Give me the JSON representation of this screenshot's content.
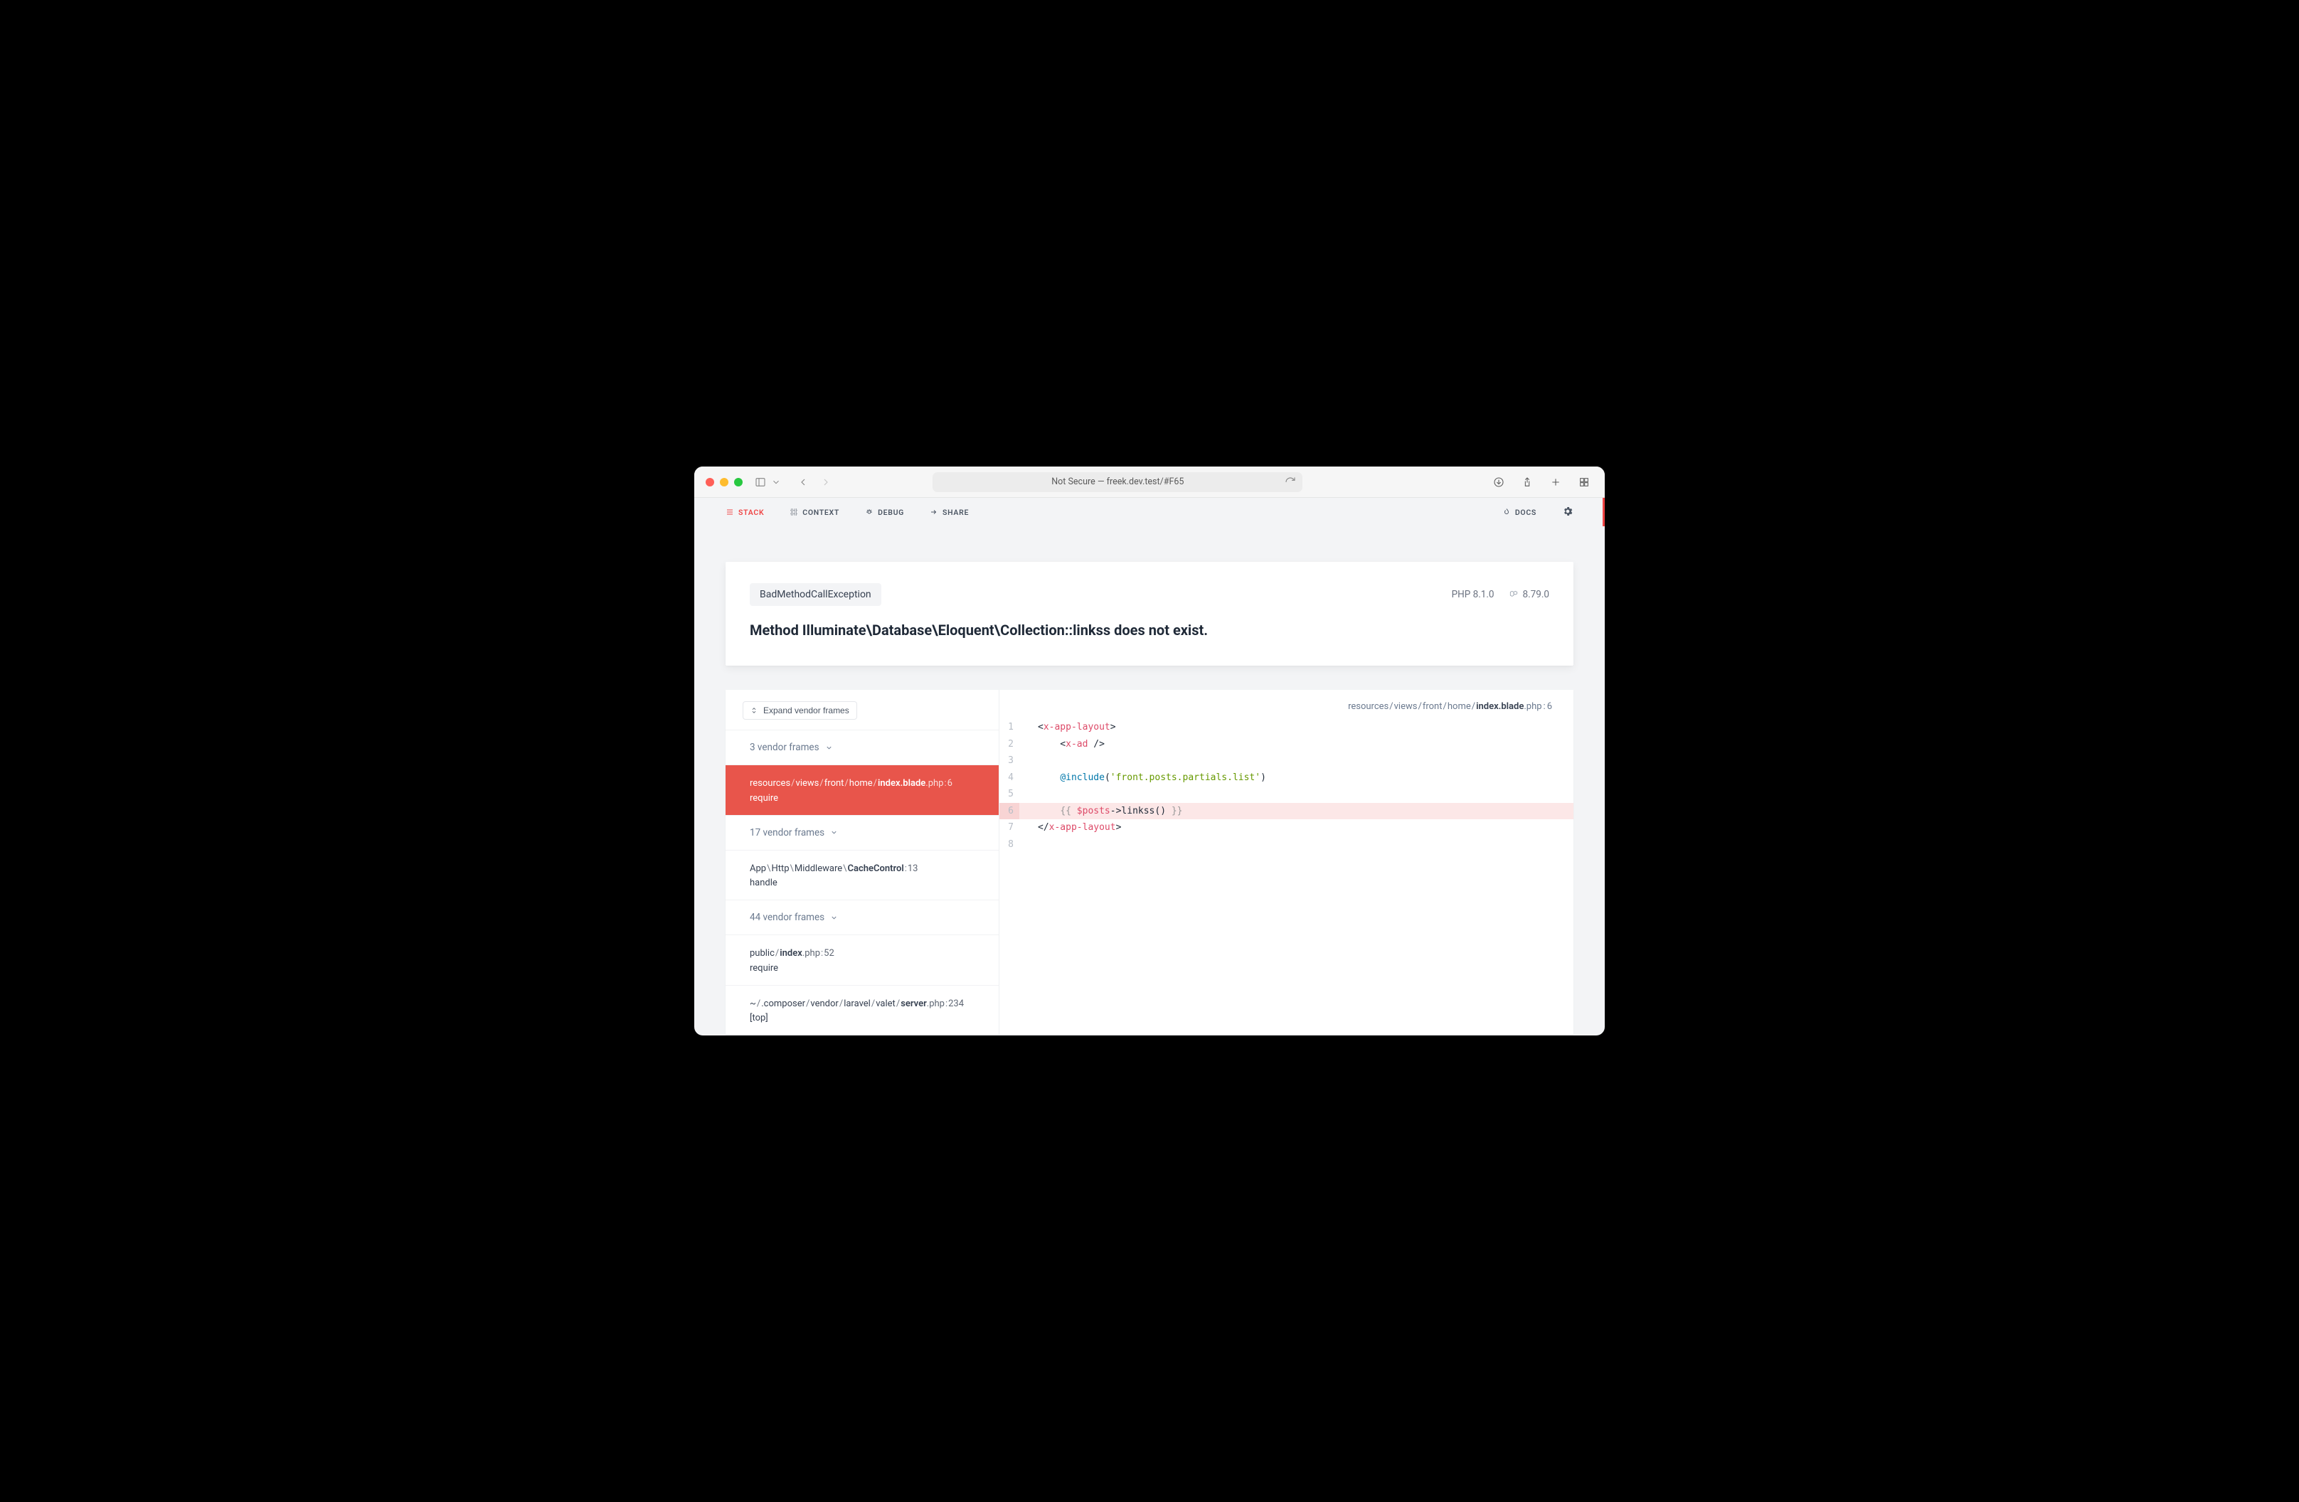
{
  "browser": {
    "url_display": "Not Secure — freek.dev.test/#F65"
  },
  "nav": {
    "items": [
      {
        "label": "STACK",
        "key": "stack",
        "active": true
      },
      {
        "label": "CONTEXT",
        "key": "context",
        "active": false
      },
      {
        "label": "DEBUG",
        "key": "debug",
        "active": false
      },
      {
        "label": "SHARE",
        "key": "share",
        "active": false
      }
    ],
    "right": {
      "docs": "DOCS"
    }
  },
  "error": {
    "exception_class": "BadMethodCallException",
    "message": "Method Illuminate\\Database\\Eloquent\\Collection::linkss does not exist.",
    "php_version": "PHP 8.1.0",
    "laravel_version": "8.79.0"
  },
  "stack": {
    "expand_label": "Expand vendor frames",
    "frames": [
      {
        "type": "vendor",
        "count": "3",
        "label": "3 vendor frames"
      },
      {
        "type": "file",
        "selected": true,
        "segments": [
          "resources",
          "views",
          "front",
          "home",
          "index.blade"
        ],
        "ext": ".php",
        "line": "6",
        "sub": "require"
      },
      {
        "type": "vendor",
        "count": "17",
        "label": "17 vendor frames"
      },
      {
        "type": "file",
        "segments": [
          "App",
          "Http",
          "Middleware",
          "CacheControl"
        ],
        "sep": "\\",
        "ext": "",
        "line": "13",
        "sub": "handle"
      },
      {
        "type": "vendor",
        "count": "44",
        "label": "44 vendor frames"
      },
      {
        "type": "file",
        "segments": [
          "public",
          "index"
        ],
        "ext": ".php",
        "line": "52",
        "sub": "require"
      },
      {
        "type": "file",
        "segments": [
          "~",
          ".composer",
          "vendor",
          "laravel",
          "valet",
          "server"
        ],
        "ext": ".php",
        "line": "234",
        "sub": "[top]"
      }
    ]
  },
  "code": {
    "header_segments": [
      "resources",
      "views",
      "front",
      "home",
      "index.blade"
    ],
    "header_ext": ".php",
    "header_line": "6",
    "lines": {
      "1": {
        "html": "&lt;<span class='tok-tag'>x-app-layout</span>&gt;"
      },
      "2": {
        "html": "    &lt;<span class='tok-tag'>x-ad</span> /&gt;"
      },
      "3": {
        "html": ""
      },
      "4": {
        "html": "    <span class='tok-kw'>@include</span>(<span class='tok-str'>'front.posts.partials.list'</span>)"
      },
      "5": {
        "html": ""
      },
      "6": {
        "html": "    <span class='tok-pn'>{{</span> <span class='tok-var'>$posts</span>-&gt;linkss() <span class='tok-pn'>}}</span>",
        "highlight": true
      },
      "7": {
        "html": "&lt;/<span class='tok-tag'>x-app-layout</span>&gt;"
      },
      "8": {
        "html": ""
      }
    }
  }
}
